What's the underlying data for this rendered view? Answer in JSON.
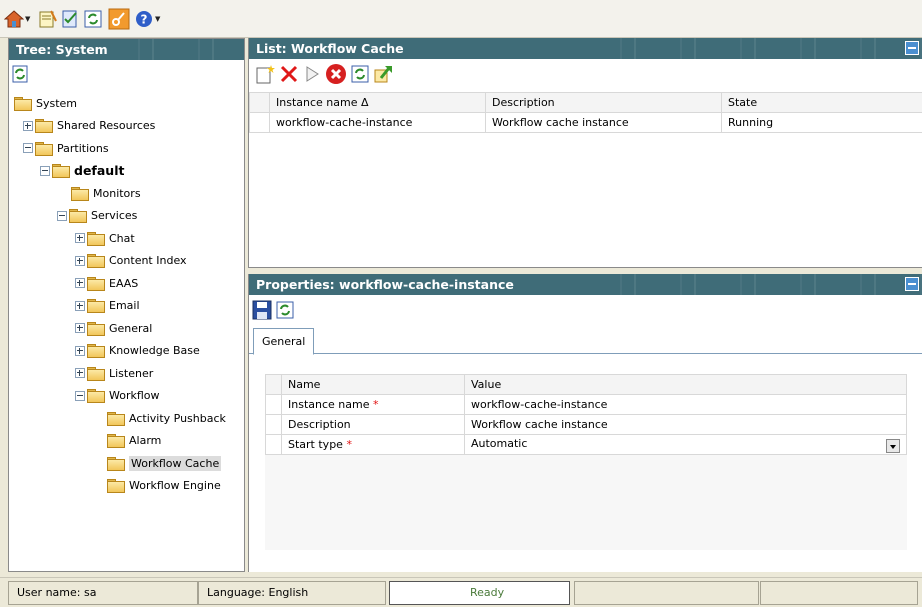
{
  "toolbar": {
    "icons": [
      "home-icon",
      "notes-icon",
      "checklist-icon",
      "refresh-icon",
      "key-icon",
      "help-icon"
    ]
  },
  "tree": {
    "title": "Tree: System",
    "items": [
      {
        "label": "System",
        "level": 0
      },
      {
        "label": "Shared Resources",
        "level": 1,
        "expander": "plus"
      },
      {
        "label": "Partitions",
        "level": 1,
        "expander": "minus"
      },
      {
        "label": "default",
        "level": 2,
        "expander": "minus",
        "bold": true
      },
      {
        "label": "Monitors",
        "level": 3
      },
      {
        "label": "Services",
        "level": 3,
        "expander": "minus"
      },
      {
        "label": "Chat",
        "level": 4,
        "expander": "plus"
      },
      {
        "label": "Content Index",
        "level": 4,
        "expander": "plus"
      },
      {
        "label": "EAAS",
        "level": 4,
        "expander": "plus"
      },
      {
        "label": "Email",
        "level": 4,
        "expander": "plus"
      },
      {
        "label": "General",
        "level": 4,
        "expander": "plus"
      },
      {
        "label": "Knowledge Base",
        "level": 4,
        "expander": "plus"
      },
      {
        "label": "Listener",
        "level": 4,
        "expander": "plus"
      },
      {
        "label": "Workflow",
        "level": 4,
        "expander": "minus"
      },
      {
        "label": "Activity Pushback",
        "level": 5
      },
      {
        "label": "Alarm",
        "level": 5
      },
      {
        "label": "Workflow Cache",
        "level": 5,
        "selected": true
      },
      {
        "label": "Workflow Engine",
        "level": 5
      }
    ]
  },
  "list": {
    "title": "List: Workflow Cache",
    "columns": [
      "Instance name Δ",
      "Description",
      "State"
    ],
    "rows": [
      [
        "workflow-cache-instance",
        "Workflow cache instance",
        "Running"
      ]
    ]
  },
  "properties": {
    "title": "Properties: workflow-cache-instance",
    "tab": "General",
    "columns": [
      "Name",
      "Value"
    ],
    "rows": [
      {
        "name": "Instance name",
        "required": "*",
        "value": "workflow-cache-instance"
      },
      {
        "name": "Description",
        "required": "",
        "value": "Workflow cache instance"
      },
      {
        "name": "Start type",
        "required": "*",
        "value": "Automatic"
      }
    ]
  },
  "status": {
    "user": "User name: sa",
    "language": "Language: English",
    "state": "Ready"
  }
}
